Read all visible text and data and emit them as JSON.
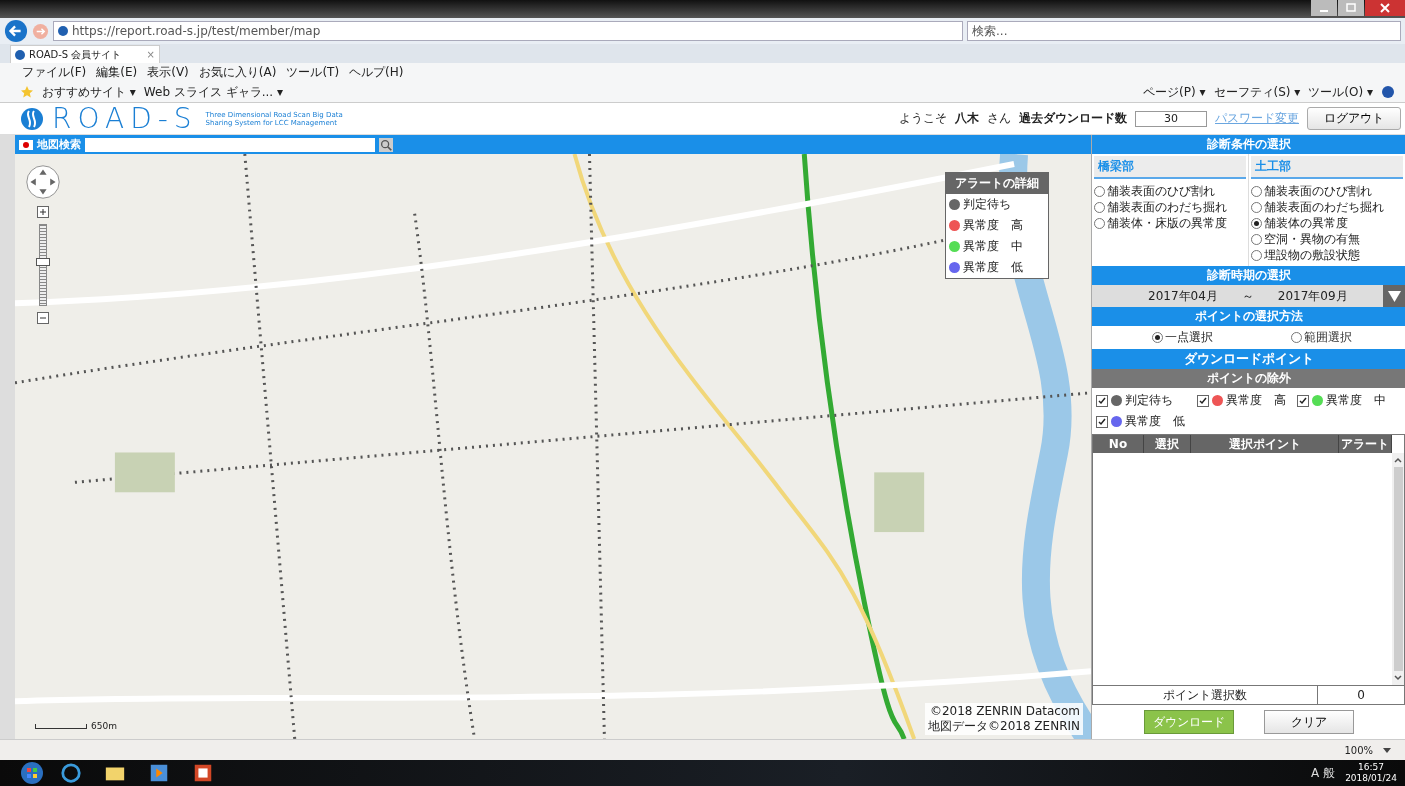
{
  "browser": {
    "url": "https://report.road-s.jp/test/member/map",
    "search_placeholder": "検索...",
    "tab": "ROAD-S 会員サイト",
    "tab_close": "×",
    "menu": [
      "ファイル(F)",
      "編集(E)",
      "表示(V)",
      "お気に入り(A)",
      "ツール(T)",
      "ヘルプ(H)"
    ],
    "favorites": [
      "おすすめサイト ▾",
      "Web スライス ギャラ... ▾"
    ],
    "commands": [
      "ページ(P) ▾",
      "セーフティ(S) ▾",
      "ツール(O) ▾"
    ]
  },
  "header": {
    "logo": "ROAD-S",
    "tagline": [
      "Three Dimensional Road Scan Big Data",
      "Sharing System for LCC Management"
    ],
    "welcome": "ようこそ",
    "user": "八木",
    "honorific": "さん",
    "downloads_label": "過去ダウンロード数",
    "downloads_value": "30",
    "password_link": "パスワード変更",
    "logout": "ログアウト"
  },
  "map_search": {
    "label": "地図検索"
  },
  "map": {
    "zoom": {
      "level": 0.55
    },
    "scale": "650m",
    "copyright": [
      "©2018 ZENRIN Datacom",
      "地図データ©2018 ZENRIN"
    ],
    "legend": {
      "title": "アラートの詳細",
      "items": [
        {
          "label": "判定待ち",
          "color": "#666666"
        },
        {
          "label": "異常度　高",
          "color": "#ee5555"
        },
        {
          "label": "異常度　中",
          "color": "#55dd55"
        },
        {
          "label": "異常度　低",
          "color": "#6666ee"
        }
      ]
    }
  },
  "panel": {
    "conditions_title": "診断条件の選択",
    "groups": [
      {
        "title": "橋梁部",
        "options": [
          {
            "label": "舗装表面のひび割れ",
            "selected": false
          },
          {
            "label": "舗装表面のわだち掘れ",
            "selected": false
          },
          {
            "label": "舗装体・床版の異常度",
            "selected": false
          }
        ]
      },
      {
        "title": "土工部",
        "options": [
          {
            "label": "舗装表面のひび割れ",
            "selected": false
          },
          {
            "label": "舗装表面のわだち掘れ",
            "selected": false
          },
          {
            "label": "舗装体の異常度",
            "selected": true
          },
          {
            "label": "空洞・異物の有無",
            "selected": false
          },
          {
            "label": "埋設物の敷設状態",
            "selected": false
          }
        ]
      }
    ],
    "period_title": "診断時期の選択",
    "period_from": "2017年04月",
    "period_sep": "～",
    "period_to": "2017年09月",
    "method_title": "ポイントの選択方法",
    "methods": [
      {
        "label": "一点選択",
        "kind": "point",
        "selected": true
      },
      {
        "label": "範囲選択",
        "kind": "range",
        "selected": false
      }
    ],
    "download_title": "ダウンロードポイント",
    "exclude_title": "ポイントの除外",
    "excludes": [
      {
        "label": "判定待ち",
        "color": "#666666",
        "checked": true
      },
      {
        "label": "異常度　高",
        "color": "#ee5555",
        "checked": true
      },
      {
        "label": "異常度　中",
        "color": "#55dd55",
        "checked": true
      },
      {
        "label": "異常度　低",
        "color": "#6666ee",
        "checked": true
      }
    ],
    "columns": [
      "No",
      "選択",
      "選択ポイント",
      "アラート"
    ],
    "count_label": "ポイント選択数",
    "count_value": "0",
    "download_button": "ダウンロード",
    "clear_button": "クリア"
  },
  "status_bar": {
    "zoom": "100%"
  },
  "taskbar": {
    "ime": "A 般",
    "time": "16:57",
    "date": "2018/01/24"
  }
}
